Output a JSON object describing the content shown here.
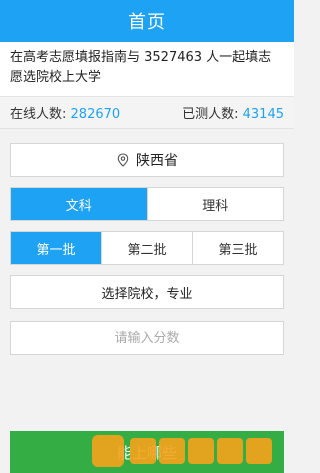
{
  "header": {
    "title": "首页"
  },
  "intro": {
    "text": "在高考志愿填报指南与 3527463 人一起填志愿选院校上大学"
  },
  "stats": {
    "online_label": "在线人数:",
    "online_value": "282670",
    "tested_label": "已测人数:",
    "tested_value": "43145"
  },
  "province": {
    "label": "陕西省",
    "icon": "location-pin-icon"
  },
  "subject": {
    "options": [
      "文科",
      "理科"
    ],
    "selected": "文科"
  },
  "batch": {
    "options": [
      "第一批",
      "第二批",
      "第三批"
    ],
    "selected": "第一批"
  },
  "school_select": {
    "label": "选择院校，专业"
  },
  "score_input": {
    "placeholder": "请输入分数",
    "value": ""
  },
  "bottom_button": {
    "label": "能上哪些"
  },
  "colors": {
    "accent": "#1ea2f4",
    "button_green": "#35ad45",
    "watermark": "#f5a21b"
  }
}
